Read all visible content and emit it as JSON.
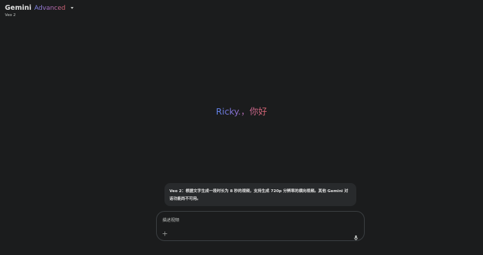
{
  "header": {
    "brand": "Gemini",
    "tier": "Advanced",
    "model": "Veo 2"
  },
  "greeting": {
    "text": "Ricky.，你好"
  },
  "notice": {
    "text": "Veo 2：根据文字生成一段时长为 8 秒的视频，支持生成 720p 分辨率的横向视频。其他 Gemini 对话功能尚不可用。"
  },
  "composer": {
    "placeholder": "描述视频",
    "value": ""
  },
  "icons": {
    "model_menu": "chevron-down-icon",
    "add": "plus-icon",
    "mic": "microphone-icon"
  },
  "colors": {
    "background": "#1b1c1d",
    "notice_bg": "#282a2c",
    "gradient_start": "#5f84ec",
    "gradient_end": "#d96570"
  }
}
